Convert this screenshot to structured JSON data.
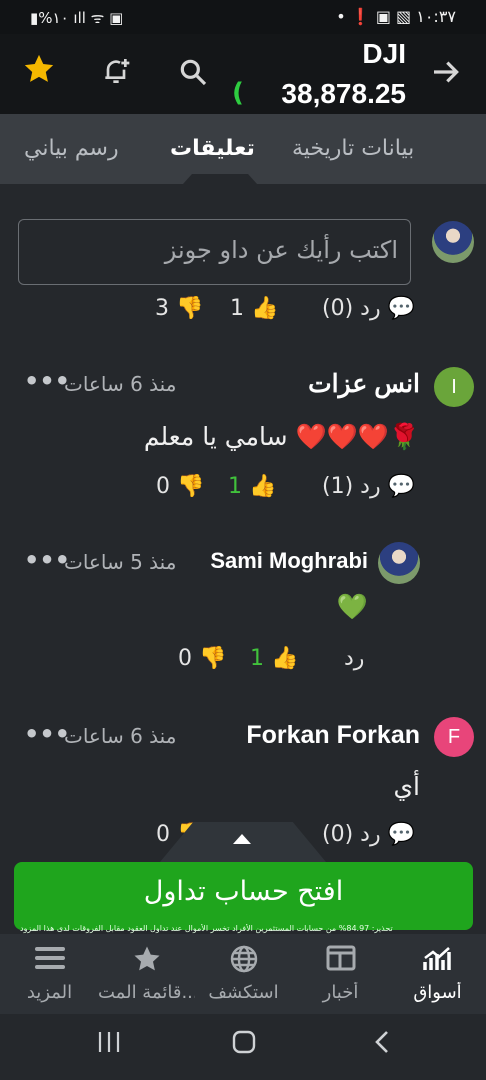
{
  "status": {
    "left": "▮%١٠ ıll ᯤ ▣",
    "right": "• ❗ ▣ ▧ ١٠:٣٧"
  },
  "header": {
    "ticker": "DJI",
    "price": "38,878.25",
    "price_fragment": "(",
    "icons": [
      "star-icon",
      "bell-plus-icon",
      "search-icon",
      "arrow-right-icon"
    ]
  },
  "tabs": [
    {
      "label": "بيانات تاريخية"
    },
    {
      "label": "تعليقات"
    },
    {
      "label": "رسم بياني"
    }
  ],
  "composer": {
    "placeholder": "اكتب رأيك عن داو جونز"
  },
  "partial_row": {
    "reply": "رد (0)",
    "dislikes": "3",
    "likes": "1"
  },
  "comments": [
    {
      "avatar_letter": "I",
      "avatar_color": "#6aa53a",
      "name": "انس عزات",
      "time": "منذ 6 ساعات",
      "text": "سامي يا معلم ❤️❤️❤️🌹",
      "reply": "رد (1)",
      "likes": "1",
      "dislikes": "0"
    },
    {
      "avatar_letter": "",
      "avatar_color": "",
      "name": "Sami Moghrabi",
      "time": "منذ 5 ساعات",
      "text": "💚",
      "reply": "رد",
      "likes": "1",
      "dislikes": "0"
    },
    {
      "avatar_letter": "F",
      "avatar_color": "#e8457a",
      "name": "Forkan Forkan",
      "time": "منذ 6 ساعات",
      "text": "أي",
      "reply": "رد (0)",
      "likes": "",
      "dislikes": "0"
    }
  ],
  "cta": {
    "label": "افتح حساب تداول",
    "disclaimer": "تحذير: 84.97% من حسابات المستثمرين الأفراد تخسر الأموال عند تداول العقود مقابل الفروقات لدى هذا المزود"
  },
  "bottom_nav": [
    {
      "label": "أسواق",
      "icon": "markets-icon"
    },
    {
      "label": "أخبار",
      "icon": "news-icon"
    },
    {
      "label": "استكشف",
      "icon": "globe-icon"
    },
    {
      "label": "قائمة المت...",
      "icon": "star-icon"
    },
    {
      "label": "المزيد",
      "icon": "menu-icon"
    }
  ]
}
